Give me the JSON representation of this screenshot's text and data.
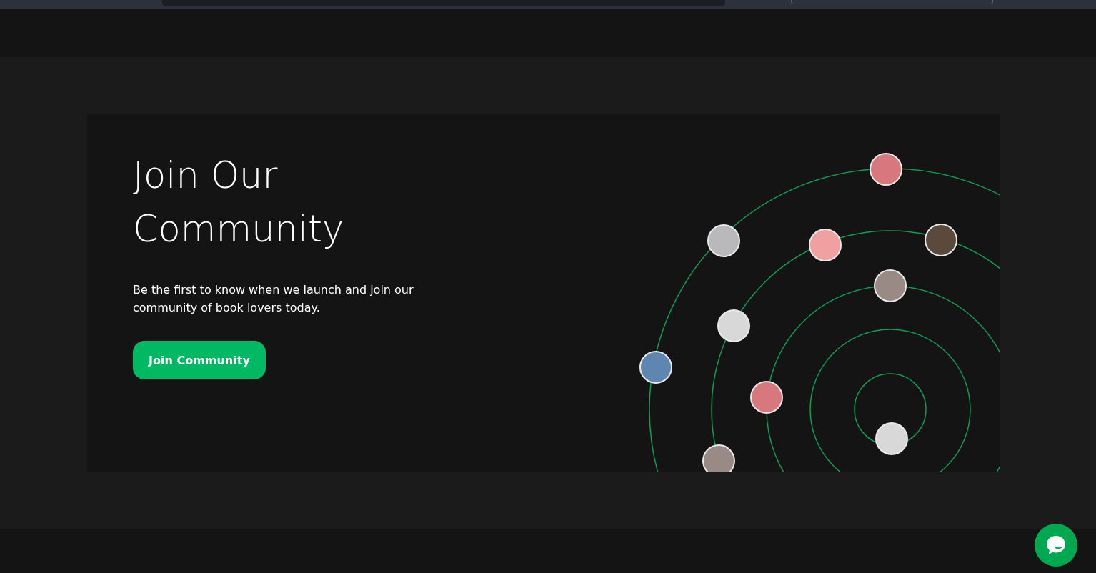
{
  "hero": {
    "title": "Join Our Community",
    "description": "Be the first to know when we launch and join our community of book lovers today.",
    "button": "Join Community"
  }
}
